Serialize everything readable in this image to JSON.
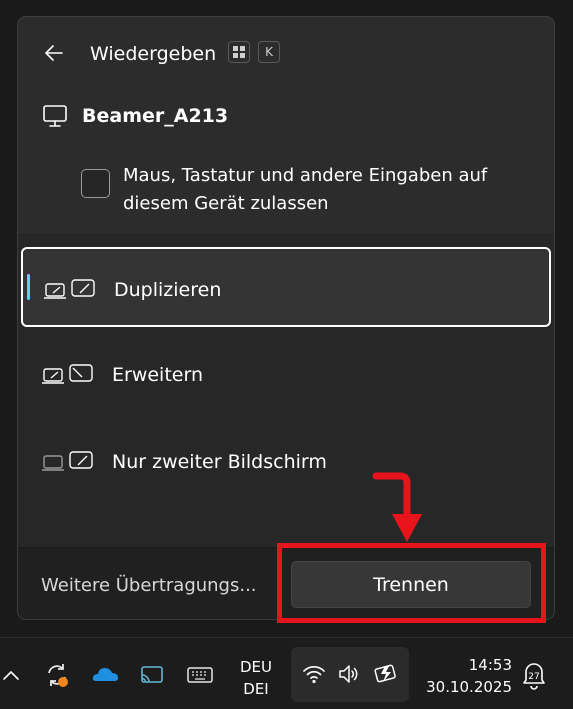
{
  "flyout": {
    "title": "Wiedergeben",
    "shortcut_keys": [
      "⊞",
      "K"
    ],
    "device_name": "Beamer_A213",
    "allow_input_label": "Maus, Tastatur und andere Eingaben auf diesem Gerät zulassen",
    "allow_input_checked": false,
    "modes": [
      {
        "label": "Duplizieren",
        "icon": "duplicate-icon",
        "selected": true
      },
      {
        "label": "Erweitern",
        "icon": "extend-icon",
        "selected": false
      },
      {
        "label": "Nur zweiter Bildschirm",
        "icon": "second-screen-only-icon",
        "selected": false
      }
    ],
    "more_link": "Weitere Übertragungs...",
    "disconnect_label": "Trennen"
  },
  "taskbar": {
    "lang_top": "DEU",
    "lang_bottom": "DEI",
    "time": "14:53",
    "date": "30.10.2025",
    "notification_count": "27"
  },
  "colors": {
    "accent": "#60cdff",
    "annotation": "#e8141c",
    "flyout_bg": "#2c2c2c"
  }
}
